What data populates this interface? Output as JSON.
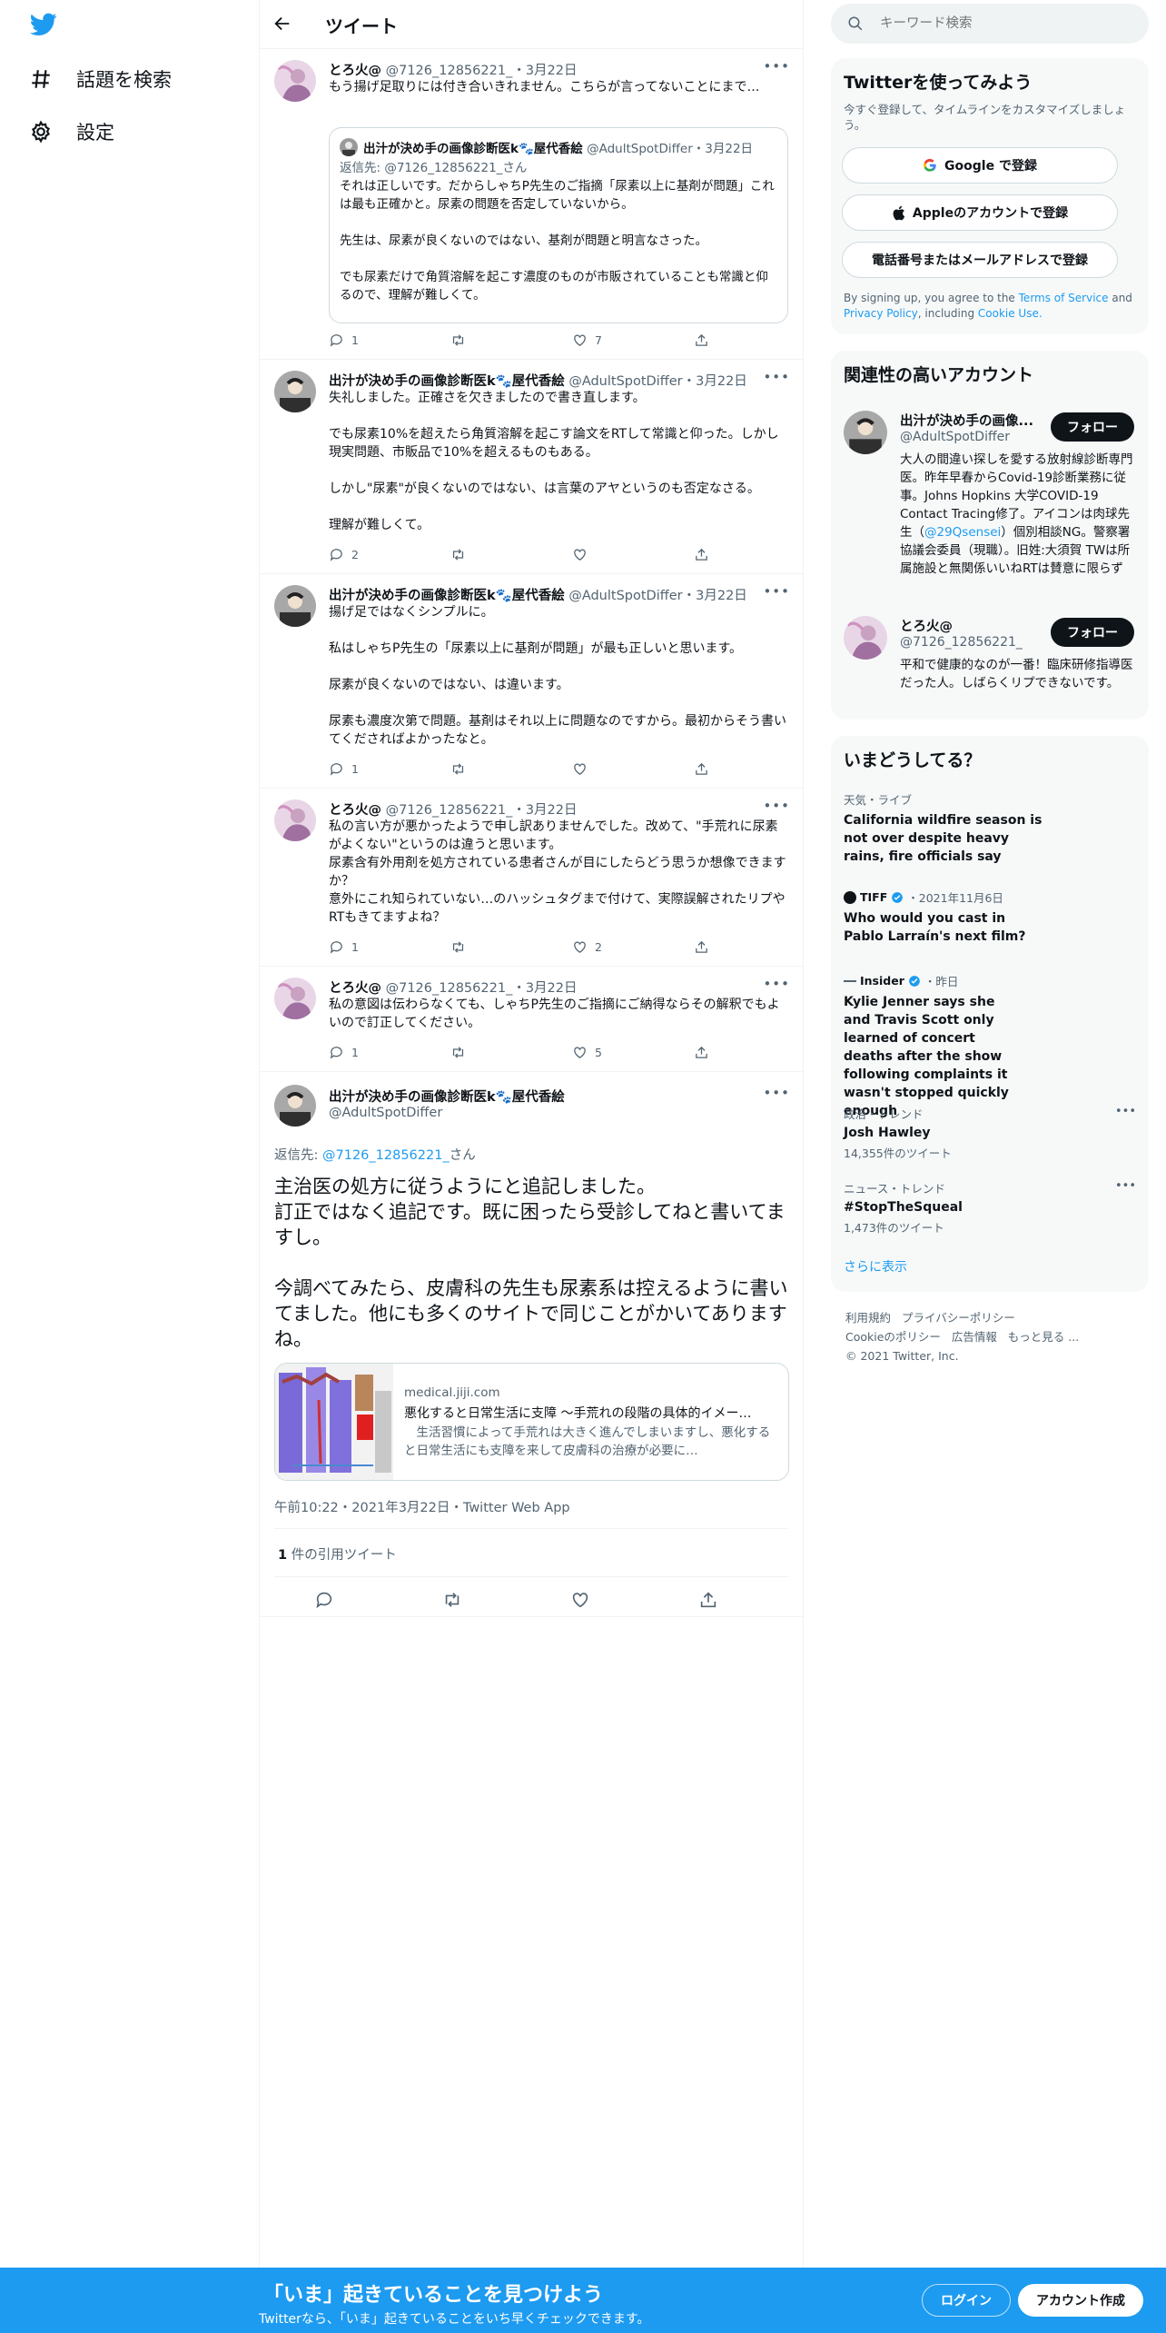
{
  "nav": {
    "explore_label": "話題を検索",
    "settings_label": "設定"
  },
  "header": {
    "title": "ツイート"
  },
  "tweets": [
    {
      "name": "とろ火@",
      "handle": "@7126_12856221_",
      "date": "3月22日",
      "text": "もう揚げ足取りには付き合いきれません。こちらが言ってないことにまで…",
      "quote": {
        "name": "出汁が決め手の画像診断医k🐾屋代香絵",
        "handle": "@AdultSpotDiffer",
        "date": "3月22日",
        "reply_prefix": "返信先: ",
        "reply_to": "@7126_12856221_",
        "reply_suffix": "さん",
        "text": "それは正しいです。だからしゃちP先生のご指摘「尿素以上に基剤が問題」これは最も正確かと。尿素の問題を否定していないから。\n\n先生は、尿素が良くないのではない、基剤が問題と明言なさった。\n\nでも尿素だけで角質溶解を起こす濃度のものが市販されていることも常識と仰るので、理解が難しくて。"
      },
      "reply_count": "1",
      "retweet_count": "",
      "like_count": "7"
    },
    {
      "name": "出汁が決め手の画像診断医k🐾屋代香絵",
      "handle": "@AdultSpotDiffer",
      "date": "3月22日",
      "text": "失礼しました。正確さを欠きましたので書き直します。\n\nでも尿素10%を超えたら角質溶解を起こす論文をRTして常識と仰った。しかし現実問題、市販品で10%を超えるものもある。\n\nしかし\"尿素\"が良くないのではない、は言葉のアヤというのも否定なさる。\n\n理解が難しくて。",
      "reply_count": "2",
      "retweet_count": "",
      "like_count": ""
    },
    {
      "name": "出汁が決め手の画像診断医k🐾屋代香絵",
      "handle": "@AdultSpotDiffer",
      "date": "3月22日",
      "text": "揚げ足ではなくシンプルに。\n\n私はしゃちP先生の「尿素以上に基剤が問題」が最も正しいと思います。\n\n尿素が良くないのではない、は違います。\n\n尿素も濃度次第で問題。基剤はそれ以上に問題なのですから。最初からそう書いてくださればよかったなと。",
      "reply_count": "1",
      "retweet_count": "",
      "like_count": ""
    },
    {
      "name": "とろ火@",
      "handle": "@7126_12856221_",
      "date": "3月22日",
      "text": "私の言い方が悪かったようで申し訳ありませんでした。改めて、\"手荒れに尿素がよくない\"というのは違うと思います。\n尿素含有外用剤を処方されている患者さんが目にしたらどう思うか想像できますか？\n意外にこれ知られていない…のハッシュタグまで付けて、実際誤解されたリプやRTもきてますよね？",
      "reply_count": "1",
      "retweet_count": "",
      "like_count": "2"
    },
    {
      "name": "とろ火@",
      "handle": "@7126_12856221_",
      "date": "3月22日",
      "text": "私の意図は伝わらなくても、しゃちP先生のご指摘にご納得ならその解釈でもよいので訂正してください。",
      "reply_count": "1",
      "retweet_count": "",
      "like_count": "5"
    }
  ],
  "main_tweet": {
    "name": "出汁が決め手の画像診断医k🐾屋代香絵",
    "handle": "@AdultSpotDiffer",
    "reply_prefix": "返信先: ",
    "reply_to": "@7126_12856221_",
    "reply_suffix": "さん",
    "text": "主治医の処方に従うようにと追記しました。\n訂正ではなく追記です。既に困ったら受診してねと書いてますし。\n\n今調べてみたら、皮膚科の先生も尿素系は控えるように書いてました。他にも多くのサイトで同じことがかいてありますね。",
    "card": {
      "domain": "medical.jiji.com",
      "title": "悪化すると日常生活に支障 ～手荒れの段階の具体的イメー…",
      "description": "　生活習慣によって手荒れは大きく進んでしまいますし、悪化すると日常生活にも支障を来して皮膚科の治療が必要に…"
    },
    "timestamp": "午前10:22・2021年3月22日・Twitter Web App",
    "quote_count": "1",
    "quote_label": " 件の引用ツイート"
  },
  "search": {
    "placeholder": "キーワード検索"
  },
  "signup": {
    "title": "Twitterを使ってみよう",
    "subtitle": "今すぐ登録して、タイムラインをカスタマイズしましょう。",
    "google_label": "Google で登録",
    "apple_label": "Appleのアカウントで登録",
    "phone_label": "電話番号またはメールアドレスで登録",
    "terms_prefix": "By signing up, you agree to the ",
    "terms_link": "Terms of Service",
    "terms_and": " and",
    "privacy_link": "Privacy Policy",
    "terms_including": ", including ",
    "cookie_link": "Cookie Use."
  },
  "related": {
    "title": "関連性の高いアカウント",
    "accounts": [
      {
        "name": "出汁が決め手の画像...",
        "handle": "@AdultSpotDiffer",
        "follow_label": "フォロー",
        "bio_1": "大人の間違い探しを愛する放射線診断専門医。昨年早春からCovid-19診断業務に従事。Johns Hopkins 大学COVID-19 Contact Tracing修了。アイコンは肉球先生（",
        "bio_link": "@29Qsensei",
        "bio_2": "）個別相談NG。警察署協議会委員（現職）。旧姓:大須賀 TWは所属施設と無関係いいねRTは賛意に限らず"
      },
      {
        "name": "とろ火@",
        "handle": "@7126_12856221_",
        "follow_label": "フォロー",
        "bio_1": "平和で健康的なのが一番！臨床研修指導医だった人。しばらくリプできないです。"
      }
    ]
  },
  "trends": {
    "title": "いまどうしてる？",
    "items": [
      {
        "meta": "天気・ライブ",
        "title": "California wildfire season is not over despite heavy rains, fire officials say"
      },
      {
        "source": "TIFF",
        "meta": "・2021年11月6日",
        "title": "Who would you cast in Pablo Larraín's next film?"
      },
      {
        "source": "Insider",
        "meta": "・昨日",
        "title": "Kylie Jenner says she and Travis Scott only learned of concert deaths after the show following complaints it wasn't stopped quickly enough"
      },
      {
        "meta": "政治・トレンド",
        "title": "Josh Hawley",
        "count": "14,355件のツイート"
      },
      {
        "meta": "ニュース・トレンド",
        "title": "#StopTheSqueal",
        "count": "1,473件のツイート"
      }
    ],
    "show_more": "さらに表示"
  },
  "footer": {
    "terms": "利用規約",
    "privacy": "プライバシーポリシー",
    "cookie": "Cookieのポリシー",
    "ads": "広告情報",
    "more": "もっと見る ...",
    "copyright": "© 2021 Twitter, Inc."
  },
  "bottombar": {
    "title": "「いま」起きていることを見つけよう",
    "subtitle": "Twitterなら、「いま」起きていることをいち早くチェックできます。",
    "login_label": "ログイン",
    "signup_label": "アカウント作成"
  },
  "colors": {
    "accent": "#1d9bf0",
    "dark": "#0f1419",
    "muted": "#536471"
  }
}
